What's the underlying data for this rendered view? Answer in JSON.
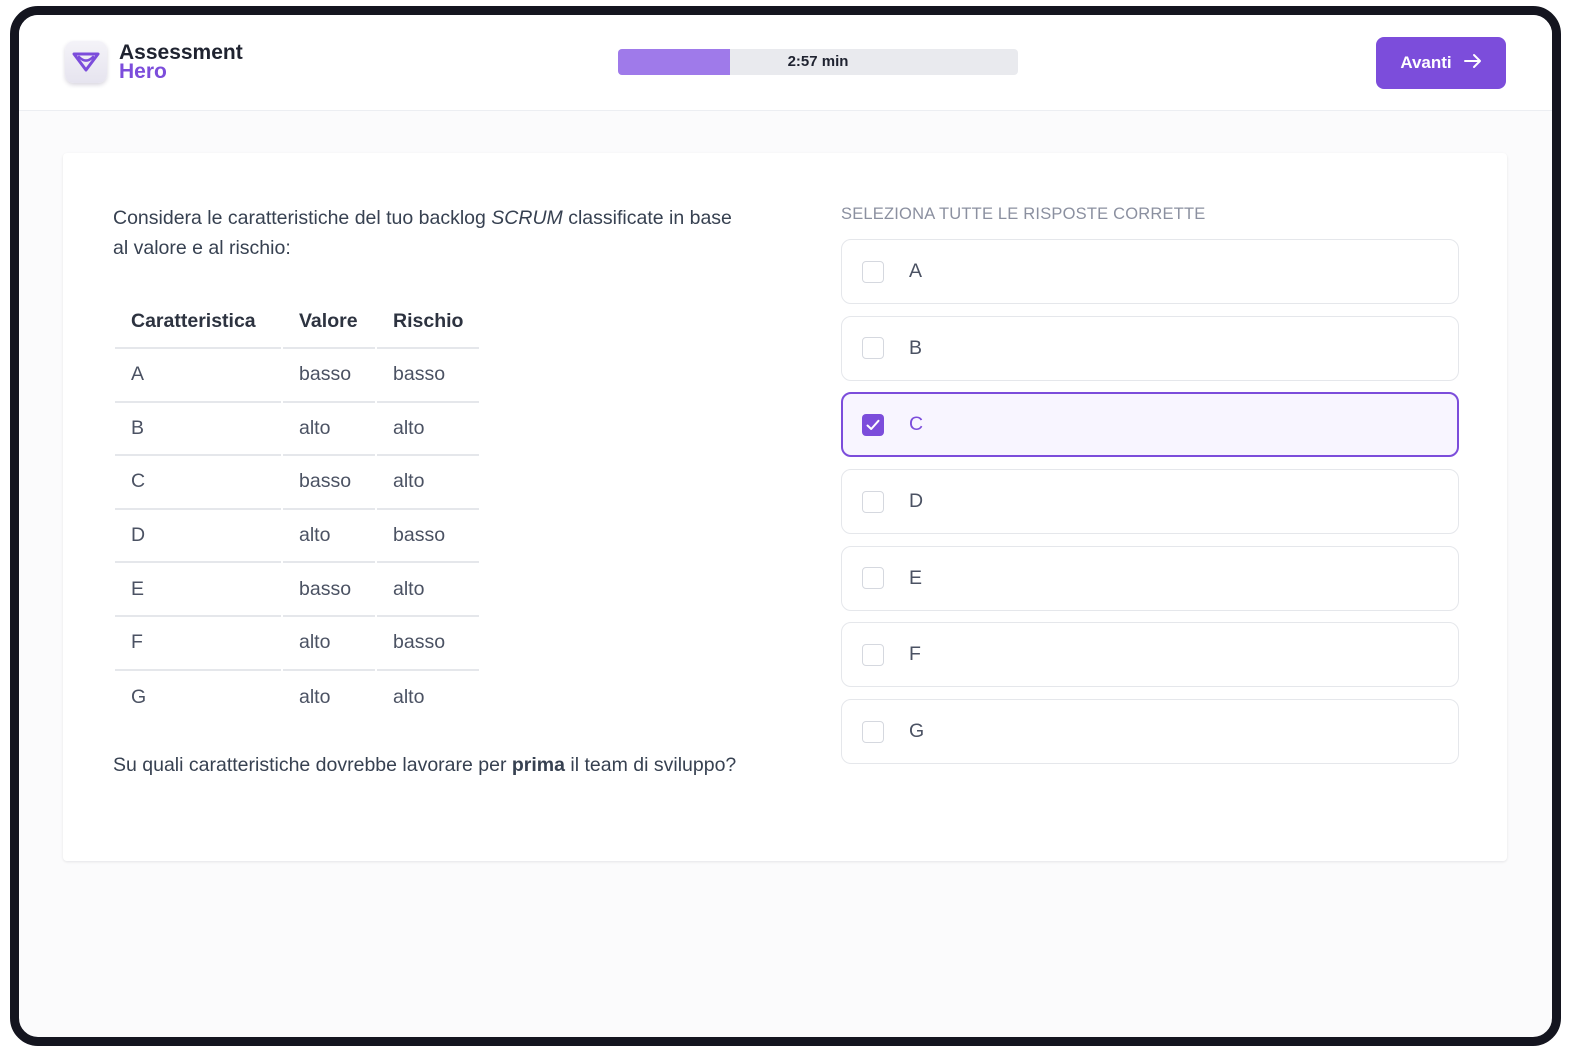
{
  "app": {
    "logo_line1": "Assessment",
    "logo_line2": "Hero",
    "brand_color": "#7c4ddb",
    "logo_icon": "heart-shield-icon"
  },
  "timer": {
    "label": "2:57 min",
    "progress_fraction": 0.28
  },
  "header": {
    "next_label": "Avanti",
    "next_icon": "arrow-right-icon"
  },
  "question": {
    "intro_before": "Considera le caratteristiche del tuo backlog ",
    "intro_emphasis": "SCRUM",
    "intro_after": " classificate in base al valore e al rischio:",
    "table": {
      "headers": [
        "Caratteristica",
        "Valore",
        "Rischio"
      ],
      "rows": [
        [
          "A",
          "basso",
          "basso"
        ],
        [
          "B",
          "alto",
          "alto"
        ],
        [
          "C",
          "basso",
          "alto"
        ],
        [
          "D",
          "alto",
          "basso"
        ],
        [
          "E",
          "basso",
          "alto"
        ],
        [
          "F",
          "alto",
          "basso"
        ],
        [
          "G",
          "alto",
          "alto"
        ]
      ]
    },
    "footer_before": "Su quali caratteristiche dovrebbe lavorare per ",
    "footer_bold": "prima",
    "footer_after": " il team di sviluppo?"
  },
  "answers": {
    "instruction": "SELEZIONA TUTTE LE RISPOSTE CORRETTE",
    "options": [
      {
        "label": "A",
        "checked": false
      },
      {
        "label": "B",
        "checked": false
      },
      {
        "label": "C",
        "checked": true
      },
      {
        "label": "D",
        "checked": false
      },
      {
        "label": "E",
        "checked": false
      },
      {
        "label": "F",
        "checked": false
      },
      {
        "label": "G",
        "checked": false
      }
    ]
  }
}
